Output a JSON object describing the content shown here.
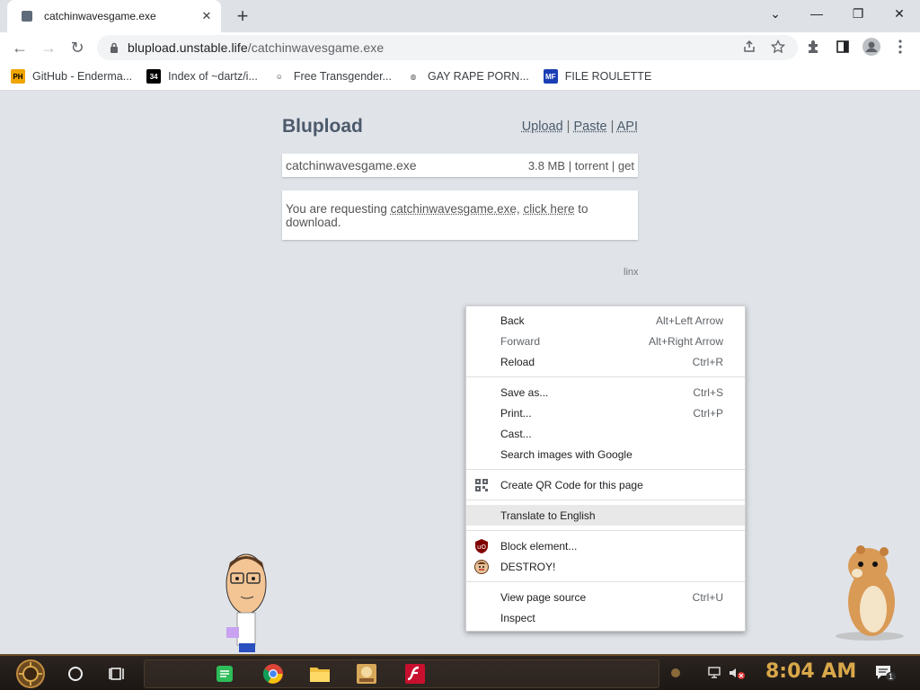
{
  "tab": {
    "title": "catchinwavesgame.exe",
    "close_glyph": "✕"
  },
  "newtab_glyph": "+",
  "window_controls": {
    "minimize": "—",
    "restore": "❐",
    "close": "✕",
    "dropdown": "⌄"
  },
  "toolbar": {
    "back": "←",
    "forward": "→",
    "reload": "↻",
    "url_host": "blupload.unstable.life",
    "url_path": "/catchinwavesgame.exe"
  },
  "bookmarks": [
    {
      "label": "GitHub - Enderma...",
      "icon": "PH",
      "icon_bg": "#f0a500",
      "icon_fg": "#000000"
    },
    {
      "label": "Index of ~dartz/i...",
      "icon": "34",
      "icon_bg": "#000000",
      "icon_fg": "#ffffff"
    },
    {
      "label": "Free Transgender...",
      "icon": "☺",
      "icon_bg": "#ffffff",
      "icon_fg": "#333333"
    },
    {
      "label": "GAY RAPE PORN...",
      "icon": "◍",
      "icon_bg": "#ffffff",
      "icon_fg": "#555555"
    },
    {
      "label": "FILE ROULETTE",
      "icon": "MF",
      "icon_bg": "#1a3fb5",
      "icon_fg": "#ffffff"
    }
  ],
  "site": {
    "logo": "Blupload",
    "links": [
      "Upload",
      "Paste",
      "API"
    ],
    "separator": "|",
    "filename": "catchinwavesgame.exe",
    "size": "3.8 MB",
    "torrent": "torrent",
    "get": "get",
    "request_prefix": "You are requesting ",
    "request_file": "catchinwavesgame.exe",
    "request_mid": ", ",
    "request_link": "click here",
    "request_suffix": " to download.",
    "footer": "linx"
  },
  "context_menu": {
    "groups": [
      [
        {
          "label": "Back",
          "shortcut": "Alt+Left Arrow"
        },
        {
          "label": "Forward",
          "shortcut": "Alt+Right Arrow",
          "disabled": true
        },
        {
          "label": "Reload",
          "shortcut": "Ctrl+R"
        }
      ],
      [
        {
          "label": "Save as...",
          "shortcut": "Ctrl+S"
        },
        {
          "label": "Print...",
          "shortcut": "Ctrl+P"
        },
        {
          "label": "Cast...",
          "shortcut": ""
        },
        {
          "label": "Search images with Google",
          "shortcut": ""
        }
      ],
      [
        {
          "label": "Create QR Code for this page",
          "shortcut": "",
          "icon": "qr-icon"
        }
      ],
      [
        {
          "label": "Translate to English",
          "shortcut": "",
          "hover": true
        }
      ],
      [
        {
          "label": "Block element...",
          "shortcut": "",
          "icon": "ublock-icon"
        },
        {
          "label": "DESTROY!",
          "shortcut": "",
          "icon": "destroy-icon"
        }
      ],
      [
        {
          "label": "View page source",
          "shortcut": "Ctrl+U"
        },
        {
          "label": "Inspect",
          "shortcut": ""
        }
      ]
    ]
  },
  "taskbar": {
    "clock": "8:04 AM",
    "accent": "#d9a84a",
    "notification_badge": "1"
  }
}
